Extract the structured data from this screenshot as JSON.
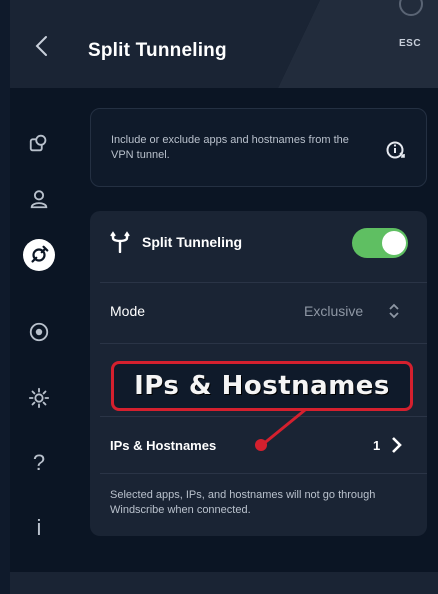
{
  "header": {
    "title": "Split Tunneling",
    "esc_label": "ESC"
  },
  "sidebar": {
    "items": [
      {
        "name": "connection-settings-icon"
      },
      {
        "name": "account-icon"
      },
      {
        "name": "split-tunneling-icon",
        "active": true
      },
      {
        "name": "robert-icon"
      },
      {
        "name": "gear-icon"
      },
      {
        "name": "help-icon",
        "glyph": "?"
      },
      {
        "name": "about-icon",
        "glyph": "i"
      }
    ]
  },
  "info": {
    "text": "Include or exclude apps and hostnames from the VPN tunnel."
  },
  "split_tunneling": {
    "label": "Split Tunneling",
    "enabled": true
  },
  "mode": {
    "label": "Mode",
    "value": "Exclusive"
  },
  "ips": {
    "label": "IPs & Hostnames",
    "count": "1"
  },
  "footer": {
    "text": "Selected apps, IPs, and hostnames will not go through Windscribe when connected."
  },
  "callout": {
    "text": "IPs & Hostnames"
  },
  "colors": {
    "toggle_on": "#5fbf62",
    "callout_border": "#d4202e",
    "background": "#0b1524",
    "card": "#1a2434"
  }
}
